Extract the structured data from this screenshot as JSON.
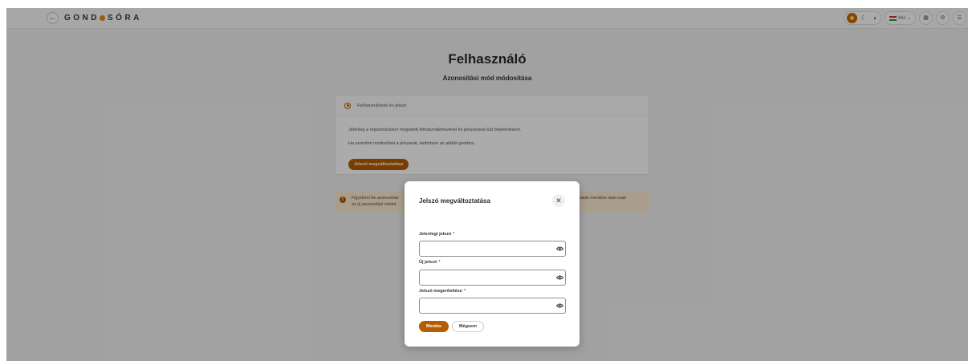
{
  "topbar": {
    "back_icon": "arrow-left-icon",
    "logo_left": "GOND",
    "logo_right": "SÓRA",
    "logo_dot_color": "#e88a1e",
    "theme_icons": [
      "sun-icon",
      "moon-icon",
      "high-contrast-icon"
    ],
    "language": "HU",
    "right_icons": [
      "grid-icon",
      "settings-icon",
      "menu-icon"
    ]
  },
  "page": {
    "title": "Felhasználó",
    "subtitle": "Azonosítási mód módosítása"
  },
  "card": {
    "option_label": "Felhasználónév és jelszó",
    "text1": "Jelenleg a regisztrációkor megadott felhasználónevével és jelszavával tud bejelentkezni.",
    "text2": "Ha szeretné módosítani a jelszavát, kattintson az alábbi gombra:",
    "button_label": "Jelszó megváltoztatása"
  },
  "warning": {
    "text_left_line1": "Figyelem! Az azonosítási",
    "text_left_line2": "az új azonosítási módot",
    "text_right": "oztatás mentése után csak"
  },
  "modal": {
    "title": "Jelszó megváltoztatása",
    "close_icon": "close-icon",
    "fields": [
      {
        "label": "Jelenlegi jelszó",
        "required": "*",
        "value": ""
      },
      {
        "label": "Új jelszó",
        "required": "*",
        "value": ""
      },
      {
        "label": "Jelszó megerősítése",
        "required": "*",
        "value": ""
      }
    ],
    "save_label": "Mentés",
    "cancel_label": "Mégsem"
  },
  "colors": {
    "accent": "#b35c00",
    "warning_bg": "#fdebd3",
    "required": "#d23a2a"
  }
}
